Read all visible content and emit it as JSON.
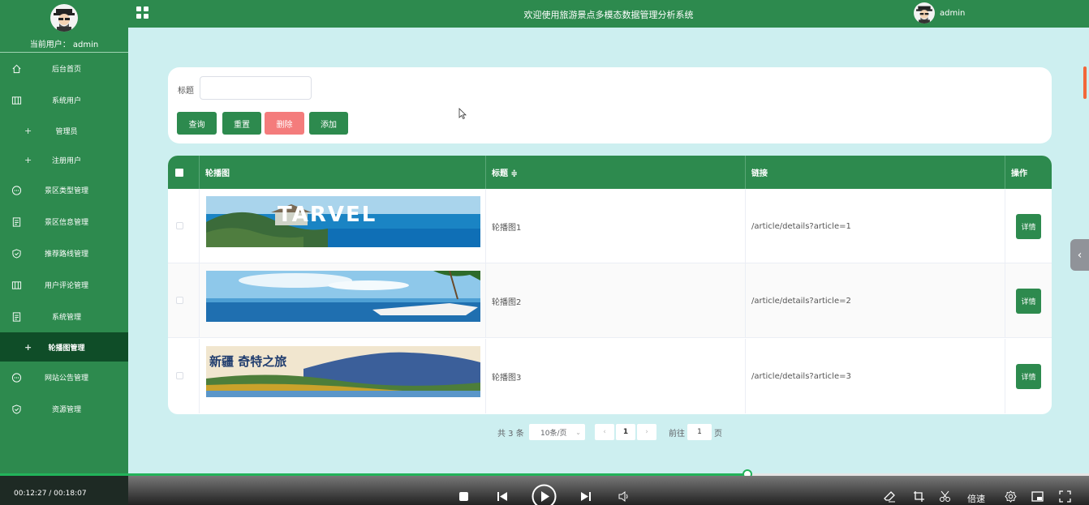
{
  "sidebar": {
    "current_user": "当前用户： admin",
    "items": [
      {
        "label": "后台首页",
        "icon": "home-icon"
      },
      {
        "label": "系统用户",
        "icon": "columns-icon"
      },
      {
        "label": "管理员",
        "icon": "plus-icon"
      },
      {
        "label": "注册用户",
        "icon": "plus-icon"
      },
      {
        "label": "景区类型管理",
        "icon": "chat-icon"
      },
      {
        "label": "景区信息管理",
        "icon": "document-icon"
      },
      {
        "label": "推荐路线管理",
        "icon": "shield-check-icon"
      },
      {
        "label": "用户评论管理",
        "icon": "columns-icon"
      },
      {
        "label": "系统管理",
        "icon": "document-icon"
      },
      {
        "label": "轮播图管理",
        "icon": "plus-icon"
      },
      {
        "label": "网站公告管理",
        "icon": "chat-icon"
      },
      {
        "label": "资源管理",
        "icon": "shield-check-icon"
      }
    ]
  },
  "header": {
    "title": "欢迎使用旅游景点多模态数据管理分析系统",
    "user": "admin"
  },
  "search": {
    "label": "标题",
    "value": "",
    "buttons": {
      "query": "查询",
      "reset": "重置",
      "delete": "删除",
      "add": "添加"
    }
  },
  "table": {
    "columns": [
      "轮播图",
      "标题 ≑",
      "链接",
      "操作"
    ],
    "rows": [
      {
        "image_text": "TARVEL",
        "title": "轮播图1",
        "link": "/article/details?article=1",
        "action": "详情"
      },
      {
        "image_text": "",
        "title": "轮播图2",
        "link": "/article/details?article=2",
        "action": "详情"
      },
      {
        "image_text": "新疆 奇特之旅",
        "title": "轮播图3",
        "link": "/article/details?article=3",
        "action": "详情"
      }
    ]
  },
  "pagination": {
    "total": "共 3 条",
    "page_size": "10条/页",
    "current_page": "1",
    "goto_label": "前往",
    "goto_value": "1",
    "page_suffix": "页"
  },
  "player": {
    "time": "00:12:27 / 00:18:07",
    "progress": 0.686,
    "rate_label": "倍速"
  },
  "colors": {
    "primary": "#2d8a4e",
    "active": "#0f4d28",
    "danger": "#f47c7c",
    "background": "#cdeff0"
  }
}
